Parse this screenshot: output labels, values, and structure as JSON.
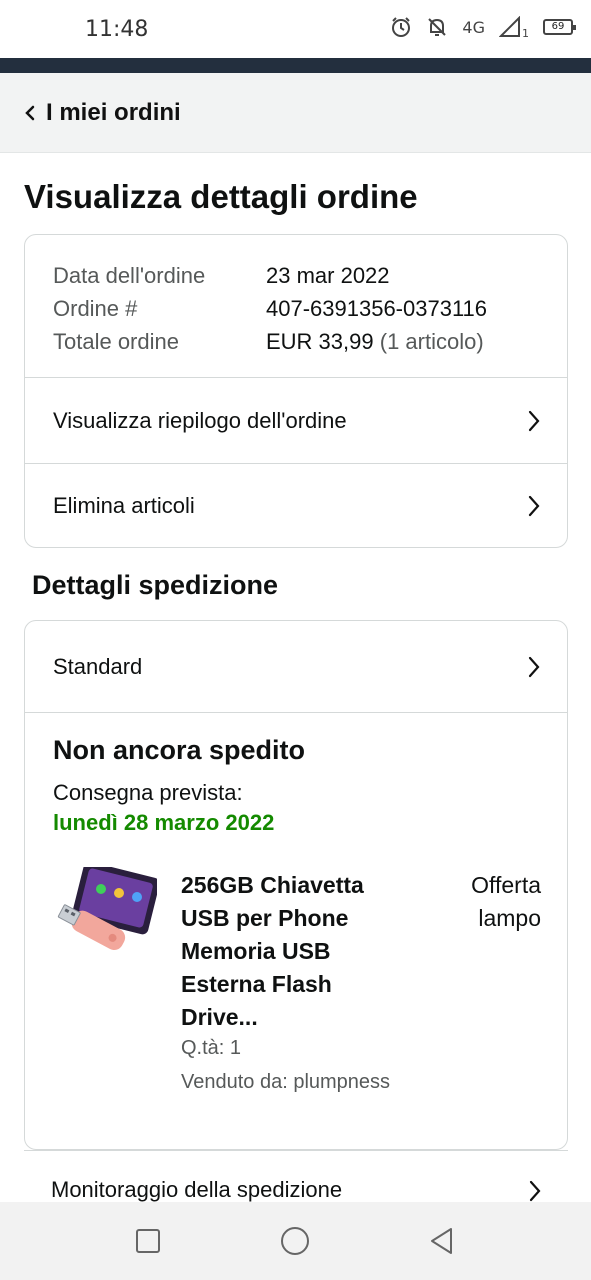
{
  "status_bar": {
    "time": "11:48",
    "network": "4G",
    "sim": "1",
    "battery": "69",
    "icons": [
      "alarm-icon",
      "bell-off-icon",
      "signal-icon",
      "battery-icon"
    ]
  },
  "header": {
    "back_label": "I miei ordini"
  },
  "page": {
    "title": "Visualizza dettagli ordine"
  },
  "order": {
    "date_label": "Data dell'ordine",
    "date_value": "23 mar 2022",
    "number_label": "Ordine #",
    "number_value": "407-6391356-0373116",
    "total_label": "Totale ordine",
    "total_value": "EUR 33,99",
    "total_items": "(1 articolo)",
    "summary_link": "Visualizza riepilogo dell'ordine",
    "remove_link": "Elimina articoli"
  },
  "shipping": {
    "section_title": "Dettagli spedizione",
    "method": "Standard",
    "status": "Non ancora spedito",
    "eta_label": "Consegna prevista:",
    "eta_date": "lunedì 28 marzo 2022",
    "eta_color": "#148a00"
  },
  "product": {
    "name": "256GB Chiavetta USB per Phone Memoria USB Esterna Flash Drive...",
    "deal": "Offerta lampo",
    "qty": "Q.tà: 1",
    "seller": "Venduto da: plumpness"
  },
  "tracking": {
    "label": "Monitoraggio della spedizione"
  },
  "colors": {
    "header_dark": "#232f3e",
    "border": "#d5d9d9",
    "muted_text": "#565959"
  }
}
